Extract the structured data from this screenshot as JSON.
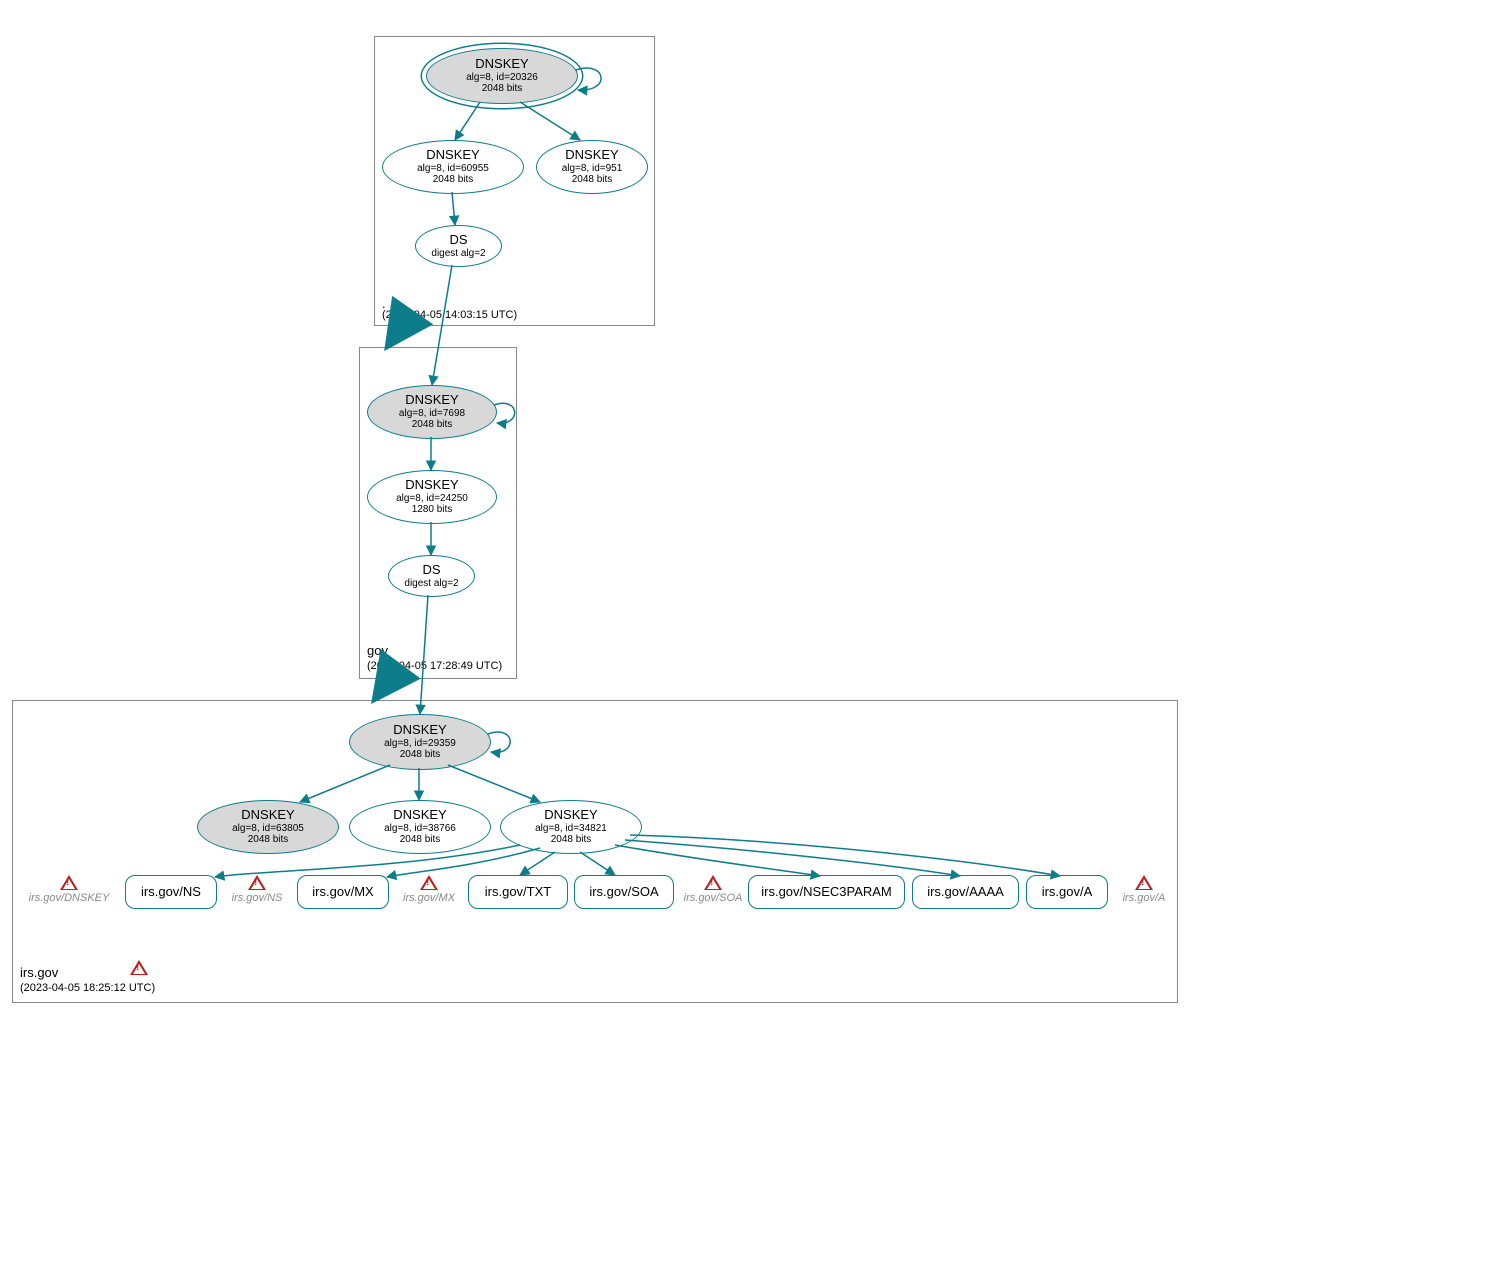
{
  "zones": {
    "root": {
      "name": ".",
      "timestamp": "(2023-04-05 14:03:15 UTC)"
    },
    "gov": {
      "name": "gov",
      "timestamp": "(2023-04-05 17:28:49 UTC)"
    },
    "irsgov": {
      "name": "irs.gov",
      "timestamp": "(2023-04-05 18:25:12 UTC)"
    }
  },
  "nodes": {
    "root_ksk": {
      "title": "DNSKEY",
      "line2": "alg=8, id=20326",
      "line3": "2048 bits"
    },
    "root_zsk1": {
      "title": "DNSKEY",
      "line2": "alg=8, id=60955",
      "line3": "2048 bits"
    },
    "root_zsk2": {
      "title": "DNSKEY",
      "line2": "alg=8, id=951",
      "line3": "2048 bits"
    },
    "root_ds": {
      "title": "DS",
      "line2": "digest alg=2",
      "line3": ""
    },
    "gov_ksk": {
      "title": "DNSKEY",
      "line2": "alg=8, id=7698",
      "line3": "2048 bits"
    },
    "gov_zsk": {
      "title": "DNSKEY",
      "line2": "alg=8, id=24250",
      "line3": "1280 bits"
    },
    "gov_ds": {
      "title": "DS",
      "line2": "digest alg=2",
      "line3": ""
    },
    "irs_ksk": {
      "title": "DNSKEY",
      "line2": "alg=8, id=29359",
      "line3": "2048 bits"
    },
    "irs_k2": {
      "title": "DNSKEY",
      "line2": "alg=8, id=63805",
      "line3": "2048 bits"
    },
    "irs_k3": {
      "title": "DNSKEY",
      "line2": "alg=8, id=38766",
      "line3": "2048 bits"
    },
    "irs_k4": {
      "title": "DNSKEY",
      "line2": "alg=8, id=34821",
      "line3": "2048 bits"
    }
  },
  "rrsets": {
    "ns": "irs.gov/NS",
    "mx": "irs.gov/MX",
    "txt": "irs.gov/TXT",
    "soa": "irs.gov/SOA",
    "nsec3p": "irs.gov/NSEC3PARAM",
    "aaaa": "irs.gov/AAAA",
    "a": "irs.gov/A"
  },
  "warnings": {
    "dnskey": "irs.gov/DNSKEY",
    "ns": "irs.gov/NS",
    "mx": "irs.gov/MX",
    "soa": "irs.gov/SOA",
    "a": "irs.gov/A"
  }
}
